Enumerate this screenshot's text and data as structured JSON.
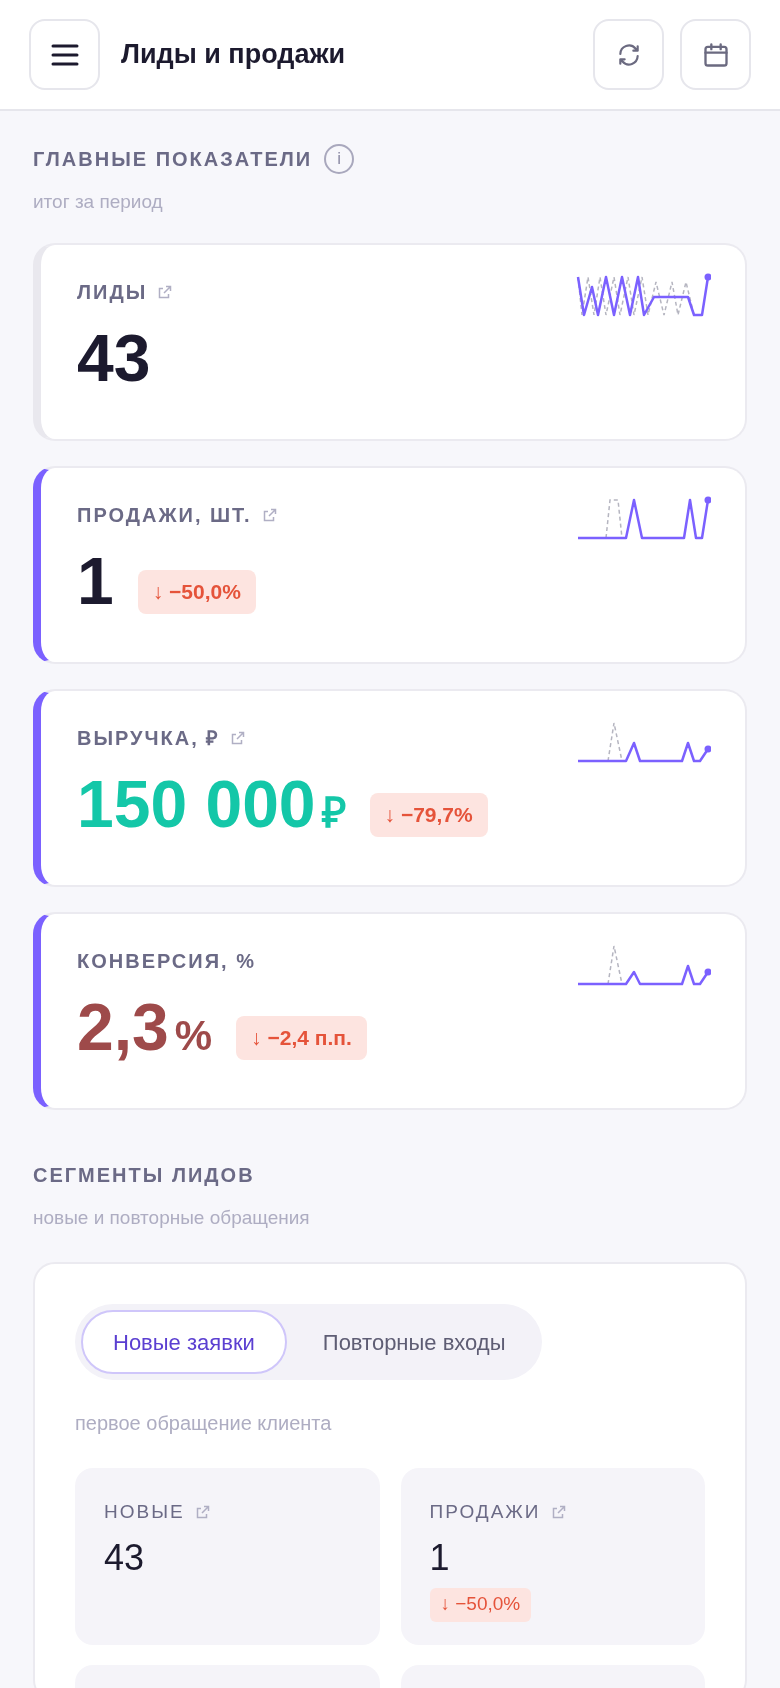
{
  "header": {
    "title": "Лиды и продажи"
  },
  "main_section": {
    "title": "ГЛАВНЫЕ ПОКАЗАТЕЛИ",
    "info": "i",
    "subtitle": "итог за период"
  },
  "metrics": [
    {
      "label": "ЛИДЫ",
      "link": true,
      "accent": false,
      "value": "43",
      "color": "#1c1a2e"
    },
    {
      "label": "ПРОДАЖИ, ШТ.",
      "link": true,
      "accent": true,
      "value": "1",
      "color": "#1c1a2e",
      "change": {
        "arrow": "↓",
        "text": "−50,0%"
      }
    },
    {
      "label": "ВЫРУЧКА, ₽",
      "link": true,
      "accent": true,
      "value": "150 000",
      "unit": "₽",
      "color": "#14c7a8",
      "change": {
        "arrow": "↓",
        "text": "−79,7%"
      }
    },
    {
      "label": "КОНВЕРСИЯ, %",
      "link": false,
      "accent": true,
      "value": "2,3",
      "unit": "%",
      "color": "#9e4a4a",
      "change": {
        "arrow": "↓",
        "text": "−2,4 п.п."
      }
    }
  ],
  "segments": {
    "title": "СЕГМЕНТЫ ЛИДОВ",
    "subtitle": "новые и повторные обращения",
    "tabs": [
      {
        "label": "Новые заявки",
        "selected": true
      },
      {
        "label": "Повторные входы",
        "selected": false
      }
    ],
    "hint": "первое обращение клиента",
    "cards": [
      {
        "label": "НОВЫЕ",
        "value": "43"
      },
      {
        "label": "ПРОДАЖИ",
        "value": "1",
        "change": {
          "arrow": "↓",
          "text": "−50,0%"
        }
      }
    ]
  }
}
